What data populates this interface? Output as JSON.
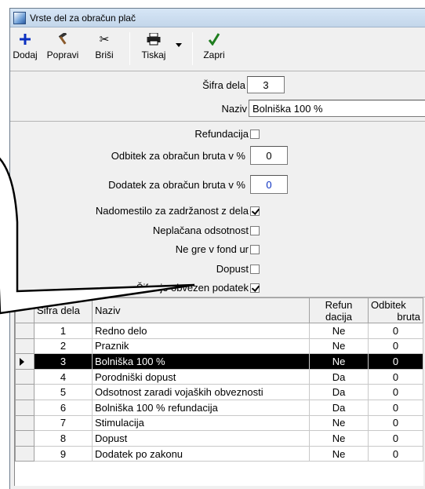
{
  "window": {
    "title": "Vrste del za obračun plač"
  },
  "toolbar": {
    "add": "Dodaj",
    "edit": "Popravi",
    "delete": "Briši",
    "print": "Tiskaj",
    "close": "Zapri"
  },
  "form": {
    "code_label": "Šifra dela",
    "code_value": "3",
    "name_label": "Naziv",
    "name_value": "Bolniška 100 %",
    "refund_label": "Refundacija",
    "deduction_label": "Odbitek za obračun bruta v %",
    "deduction_value": "0",
    "addition_label": "Dodatek za obračun bruta v %",
    "addition_value": "0",
    "compensation_label": "Nadomestilo za zadržanost z dela",
    "unpaid_label": "Neplačana odsotnost",
    "nofund_label": "Ne gre v fond ur",
    "leave_label": "Dopust",
    "required_label": "Šifra je obvezen podatek"
  },
  "grid": {
    "headers": {
      "code": "Šifra dela",
      "name": "Naziv",
      "refund_1": "Refun",
      "refund_2": "dacija",
      "deduct_1": "Odbitek",
      "deduct_2": "bruta"
    },
    "rows": [
      {
        "code": "1",
        "name": "Redno delo",
        "refund": "Ne",
        "deduct": "0"
      },
      {
        "code": "2",
        "name": "Praznik",
        "refund": "Ne",
        "deduct": "0"
      },
      {
        "code": "3",
        "name": "Bolniška 100 %",
        "refund": "Ne",
        "deduct": "0"
      },
      {
        "code": "4",
        "name": "Porodniški dopust",
        "refund": "Da",
        "deduct": "0"
      },
      {
        "code": "5",
        "name": "Odsotnost zaradi vojaških obveznosti",
        "refund": "Da",
        "deduct": "0"
      },
      {
        "code": "6",
        "name": "Bolniška 100 % refundacija",
        "refund": "Da",
        "deduct": "0"
      },
      {
        "code": "7",
        "name": "Stimulacija",
        "refund": "Ne",
        "deduct": "0"
      },
      {
        "code": "8",
        "name": "Dopust",
        "refund": "Ne",
        "deduct": "0"
      },
      {
        "code": "9",
        "name": "Dodatek po zakonu",
        "refund": "Ne",
        "deduct": "0"
      }
    ]
  }
}
